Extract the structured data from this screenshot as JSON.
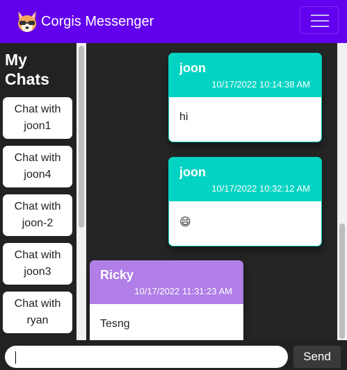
{
  "app": {
    "title": "Corgis Messenger",
    "logo_icon": "corgi-logo-icon"
  },
  "sidebar": {
    "heading": "My Chats",
    "chats": [
      {
        "label": "Chat with joon1"
      },
      {
        "label": "Chat with joon4"
      },
      {
        "label": "Chat with joon-2"
      },
      {
        "label": "Chat with joon3"
      },
      {
        "label": "Chat with ryan"
      }
    ]
  },
  "messages": [
    {
      "sender": "joon",
      "time": "10/17/2022 10:14:38 AM",
      "text": "hi",
      "color": "#03d3c2"
    },
    {
      "sender": "joon",
      "time": "10/17/2022 10:32:12 AM",
      "text": "😄",
      "color": "#03d3c2"
    },
    {
      "sender": "Ricky",
      "time": "10/17/2022 11:31:23 AM",
      "text": "Tesng",
      "color": "#b07ee6"
    }
  ],
  "composer": {
    "value": "",
    "send_label": "Send"
  },
  "colors": {
    "navbar": "#6200ee",
    "sidebar": "#222222",
    "teal": "#03d3c2",
    "purple": "#b07ee6"
  }
}
